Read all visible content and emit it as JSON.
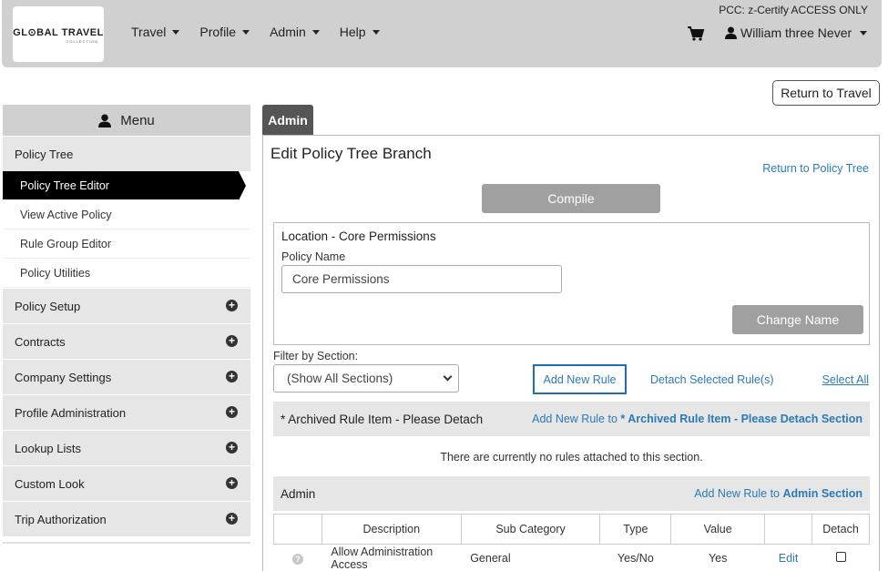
{
  "header": {
    "logo_line1": "GL⊙BAL TRAVEL",
    "logo_line2": "COLLECTION",
    "nav": [
      "Travel",
      "Profile",
      "Admin",
      "Help"
    ],
    "pcc": "PCC: z-Certify ACCESS ONLY",
    "user": "William three Never"
  },
  "return_to_travel": "Return to Travel",
  "sidebar": {
    "menu_title": "Menu",
    "policy_tree": "Policy Tree",
    "sub_items": [
      "Policy Tree Editor",
      "View Active Policy",
      "Rule Group Editor",
      "Policy Utilities"
    ],
    "sections": [
      "Policy Setup",
      "Contracts",
      "Company Settings",
      "Profile Administration",
      "Lookup Lists",
      "Custom Look",
      "Trip Authorization"
    ]
  },
  "main": {
    "tab": "Admin",
    "title": "Edit Policy Tree Branch",
    "return_link": "Return to Policy Tree",
    "compile": "Compile",
    "location_title": "Location - Core Permissions",
    "policy_name_label": "Policy Name",
    "policy_name_value": "Core Permissions",
    "change_name": "Change Name",
    "filter_label": "Filter by Section:",
    "filter_value": "(Show All Sections)",
    "add_new_rule": "Add New Rule",
    "detach_selected": "Detach Selected Rule(s)",
    "select_all": "Select All",
    "archived_title": "* Archived Rule Item - Please Detach",
    "archived_link_prefix": "Add New Rule to ",
    "archived_link_bold": "* Archived Rule Item - Please Detach Section",
    "no_rules": "There are currently no rules attached to this section.",
    "admin_title": "Admin",
    "admin_link_prefix": "Add New Rule to ",
    "admin_link_bold": "Admin Section",
    "table": {
      "headers": [
        "",
        "Description",
        "Sub Category",
        "Type",
        "Value",
        "",
        "Detach"
      ],
      "rows": [
        {
          "description": "Allow Administration Access",
          "sub_category": "General",
          "type": "Yes/No",
          "value": "Yes",
          "edit": "Edit"
        }
      ]
    }
  }
}
